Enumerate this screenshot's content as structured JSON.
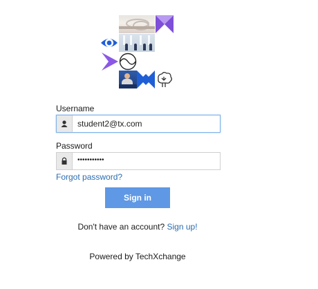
{
  "form": {
    "username_label": "Username",
    "username_value": "student2@tx.com",
    "password_label": "Password",
    "password_value": "•••••••••••",
    "forgot_link": "Forgot password?",
    "signin_label": "Sign in",
    "signup_prompt": "Don't have an account?",
    "signup_link": "Sign up!"
  },
  "footer": {
    "powered_by": "Powered by TechXchange"
  },
  "icons": {
    "user": "user-icon",
    "lock": "lock-icon",
    "logo": [
      "eye-icon",
      "arrow-icon",
      "wave-icon",
      "diamond-icon",
      "brain-icon",
      "bowtie-icon"
    ]
  },
  "colors": {
    "accent_purple": "#8b58e6",
    "accent_blue": "#1f5fd6",
    "button": "#5f98e4",
    "link": "#2b6cb0",
    "focus_border": "#7fb2e8"
  }
}
